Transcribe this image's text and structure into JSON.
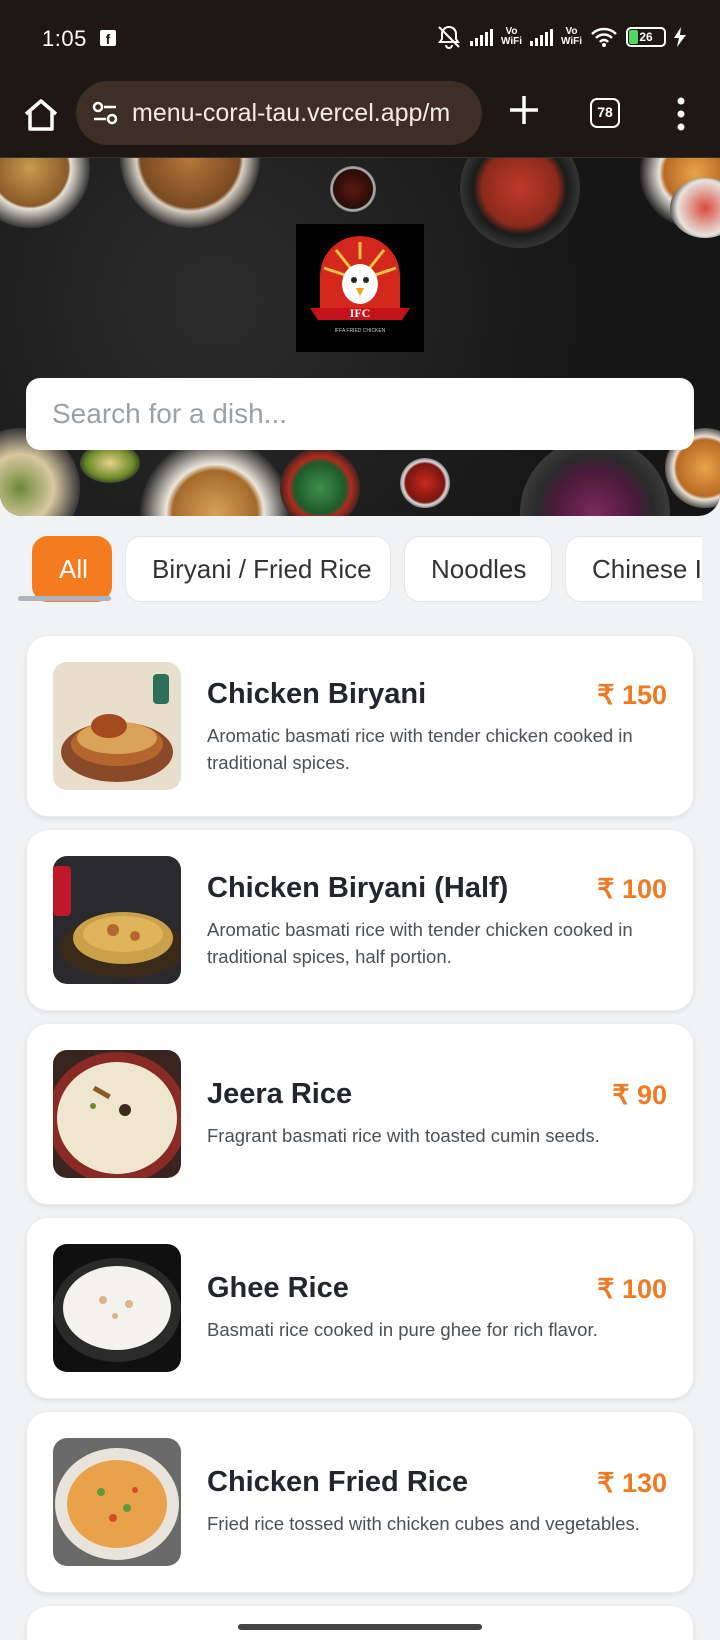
{
  "status_bar": {
    "time": "1:05",
    "battery": "26",
    "vo_wifi_label": "Vo\nWiFi"
  },
  "browser": {
    "url": "menu-coral-tau.vercel.app/m",
    "tab_count": "78"
  },
  "hero": {
    "logo_text": "IFC",
    "logo_subtext": "IFFA FRIED CHICKEN",
    "search_placeholder": "Search for a dish..."
  },
  "categories": [
    {
      "label": "All",
      "active": true
    },
    {
      "label": "Biryani / Fried Rice",
      "active": false
    },
    {
      "label": "Noodles",
      "active": false
    },
    {
      "label": "Chinese It",
      "active": false
    }
  ],
  "menu_items": [
    {
      "name": "Chicken Biryani",
      "price": "₹ 150",
      "description": "Aromatic basmati rice with tender chicken cooked in traditional spices."
    },
    {
      "name": "Chicken Biryani (Half)",
      "price": "₹ 100",
      "description": "Aromatic basmati rice with tender chicken cooked in traditional spices, half portion."
    },
    {
      "name": "Jeera Rice",
      "price": "₹ 90",
      "description": "Fragrant basmati rice with toasted cumin seeds."
    },
    {
      "name": "Ghee Rice",
      "price": "₹ 100",
      "description": "Basmati rice cooked in pure ghee for rich flavor."
    },
    {
      "name": "Chicken Fried Rice",
      "price": "₹ 130",
      "description": "Fried rice tossed with chicken cubes and vegetables."
    }
  ],
  "colors": {
    "accent": "#f47b20",
    "price": "#ef7a22",
    "status_bar_bg": "#1e1714"
  }
}
